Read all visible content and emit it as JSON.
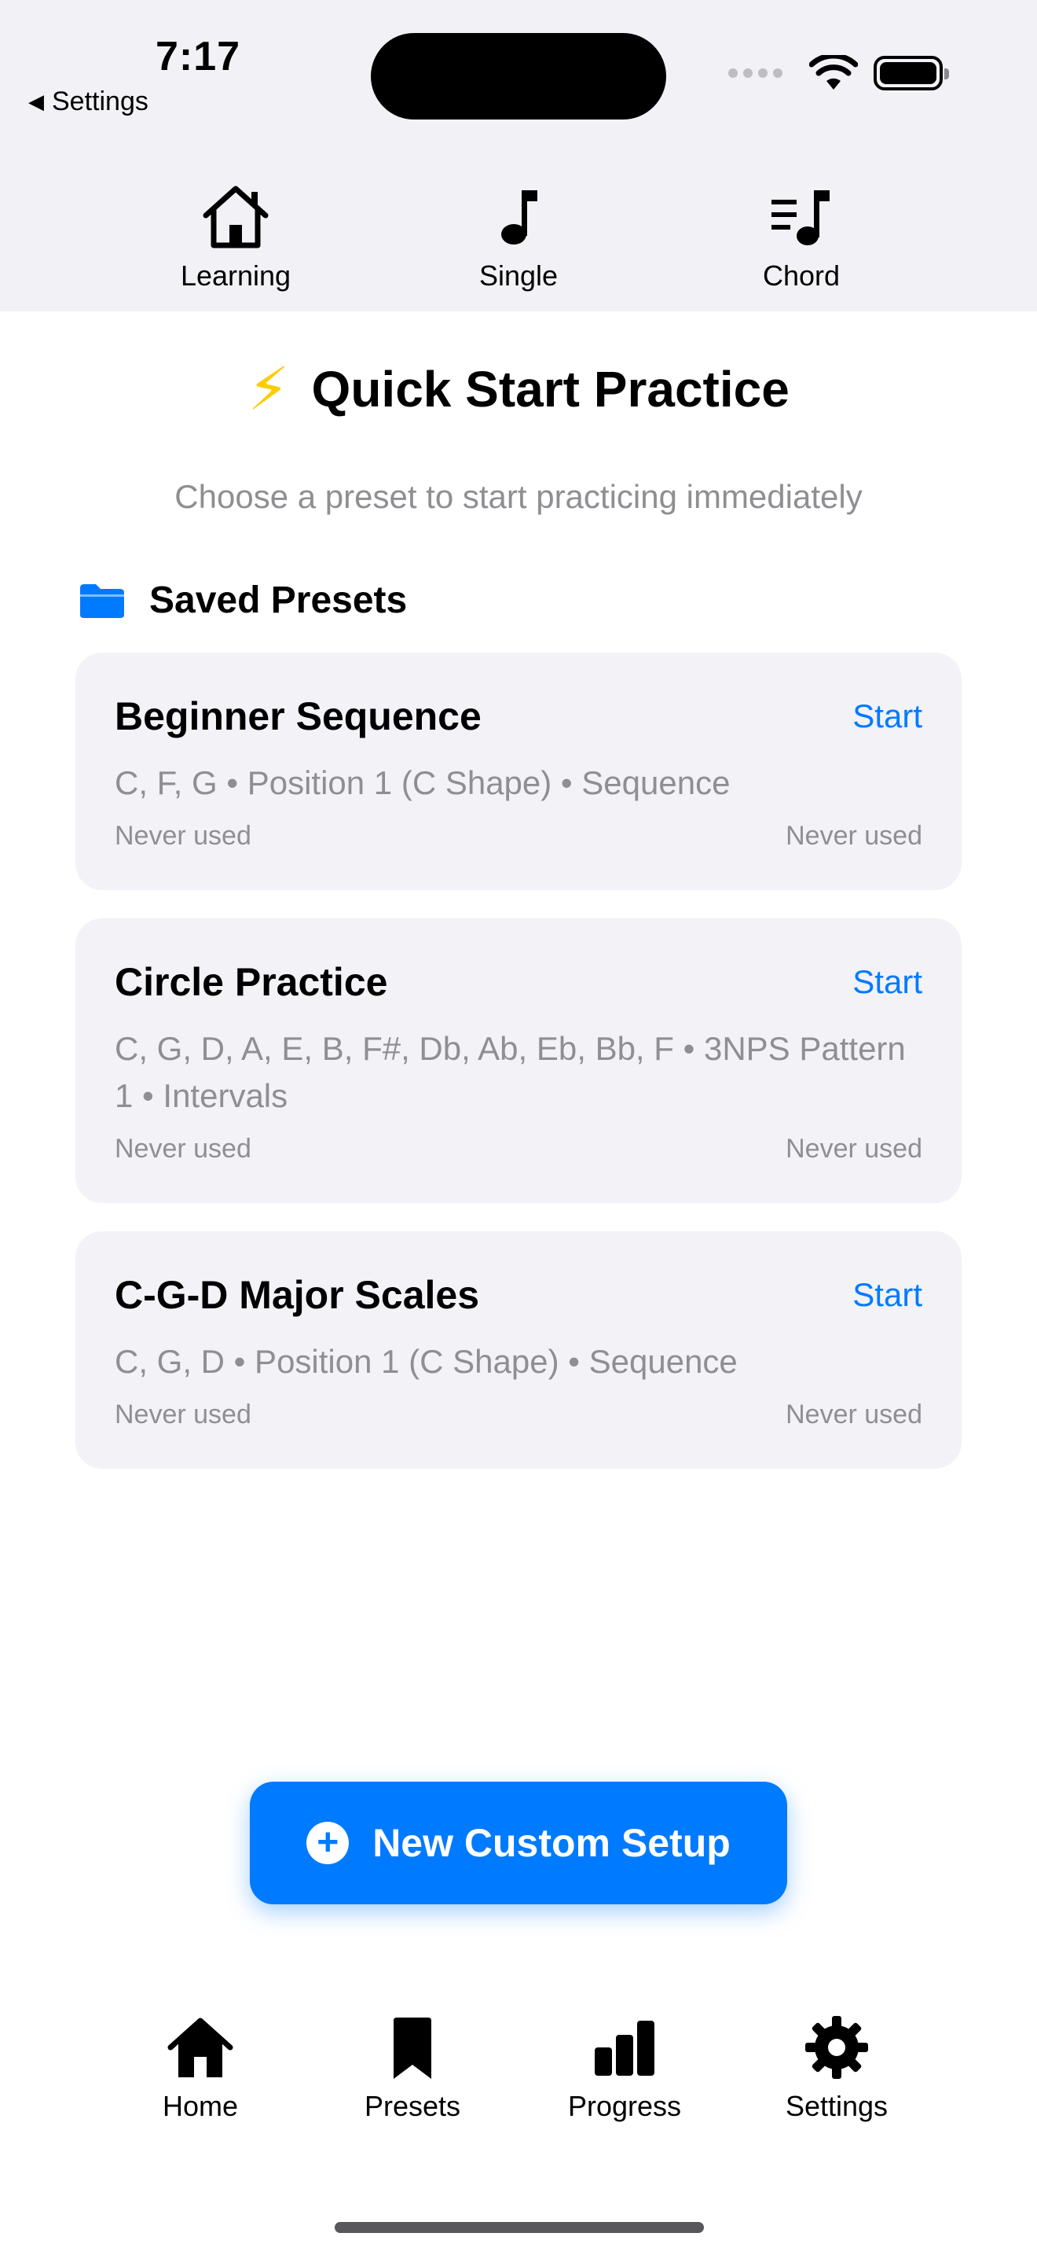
{
  "status_bar": {
    "time": "7:17",
    "back_label": "Settings",
    "icons": [
      "signal-dots-icon",
      "wifi-icon",
      "battery-icon"
    ]
  },
  "top_tabs": [
    {
      "label": "Learning",
      "icon": "house-icon"
    },
    {
      "label": "Single",
      "icon": "music-note-icon"
    },
    {
      "label": "Chord",
      "icon": "music-list-icon"
    }
  ],
  "header": {
    "title_icon": "⚡",
    "title": "Quick Start Practice",
    "subtitle": "Choose a preset to start practicing immediately"
  },
  "saved_section": {
    "title": "Saved Presets",
    "icon": "folder-icon",
    "presets": [
      {
        "name": "Beginner Sequence",
        "action": "Start",
        "description": "C, F, G • Position 1 (C Shape) • Sequence",
        "last_used_left": "Never used",
        "last_used_right": "Never used"
      },
      {
        "name": "Circle Practice",
        "action": "Start",
        "description": "C, G, D, A, E, B, F#, Db, Ab, Eb, Bb, F • 3NPS Pattern 1 • Intervals",
        "last_used_left": "Never used",
        "last_used_right": "Never used"
      },
      {
        "name": "C-G-D Major Scales",
        "action": "Start",
        "description": "C, G, D • Position 1 (C Shape) • Sequence",
        "last_used_left": "Never used",
        "last_used_right": "Never used"
      }
    ]
  },
  "primary_action": {
    "label": "New Custom Setup",
    "icon": "plus-circle-icon"
  },
  "bottom_tabs": [
    {
      "label": "Home",
      "icon": "house-fill-icon"
    },
    {
      "label": "Presets",
      "icon": "bookmark-icon"
    },
    {
      "label": "Progress",
      "icon": "bar-chart-icon"
    },
    {
      "label": "Settings",
      "icon": "gear-icon"
    }
  ],
  "colors": {
    "accent": "#007aff",
    "bolt": "#ffcc00",
    "secondary_text": "#8e8e93",
    "card_bg": "#f2f2f7"
  }
}
